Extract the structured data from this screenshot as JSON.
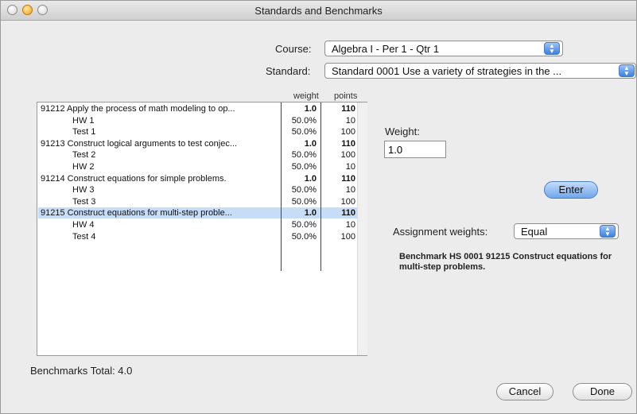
{
  "window": {
    "title": "Standards and Benchmarks"
  },
  "course": {
    "label": "Course:",
    "value": "Algebra I - Per 1 - Qtr 1"
  },
  "standard": {
    "label": "Standard:",
    "value": "Standard 0001 Use a variety of strategies in the ..."
  },
  "table": {
    "columns": {
      "weight": "weight",
      "points": "points"
    },
    "rows": [
      {
        "name": "91212 Apply the process of math modeling to op...",
        "weight": "1.0",
        "points": "110",
        "type": "parent"
      },
      {
        "name": "HW 1",
        "weight": "50.0%",
        "points": "10",
        "type": "child"
      },
      {
        "name": "Test 1",
        "weight": "50.0%",
        "points": "100",
        "type": "child"
      },
      {
        "name": "91213 Construct logical arguments to test conjec...",
        "weight": "1.0",
        "points": "110",
        "type": "parent"
      },
      {
        "name": "Test 2",
        "weight": "50.0%",
        "points": "100",
        "type": "child"
      },
      {
        "name": "HW 2",
        "weight": "50.0%",
        "points": "10",
        "type": "child"
      },
      {
        "name": "91214 Construct equations for simple problems.",
        "weight": "1.0",
        "points": "110",
        "type": "parent"
      },
      {
        "name": "HW 3",
        "weight": "50.0%",
        "points": "10",
        "type": "child"
      },
      {
        "name": "Test 3",
        "weight": "50.0%",
        "points": "100",
        "type": "child"
      },
      {
        "name": "91215 Construct equations for multi-step proble...",
        "weight": "1.0",
        "points": "110",
        "type": "parent",
        "selected": true
      },
      {
        "name": "HW 4",
        "weight": "50.0%",
        "points": "10",
        "type": "child"
      },
      {
        "name": "Test 4",
        "weight": "50.0%",
        "points": "100",
        "type": "child"
      }
    ]
  },
  "weight": {
    "label": "Weight:",
    "value": "1.0"
  },
  "enter_button": "Enter",
  "assignment_weights": {
    "label": "Assignment weights:",
    "value": "Equal"
  },
  "description": "Benchmark HS 0001 91215 Construct equations for multi-step problems.",
  "benchmarks_total": "Benchmarks Total: 4.0",
  "cancel_button": "Cancel",
  "done_button": "Done",
  "colors": {
    "selection": "#c7dcf6",
    "accent": "#3b80e3"
  }
}
